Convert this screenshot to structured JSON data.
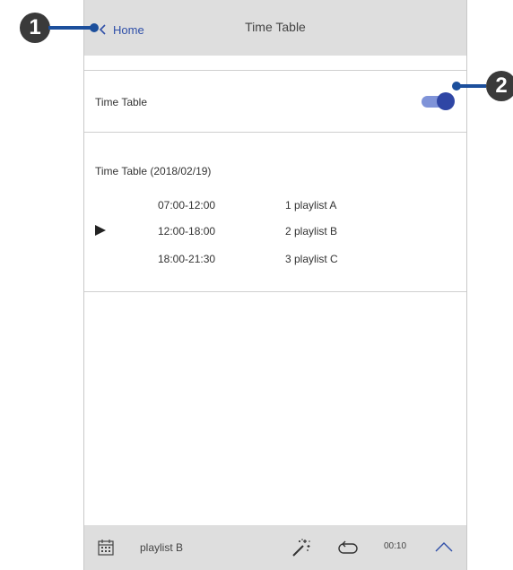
{
  "header": {
    "back_label": "Home",
    "title": "Time Table"
  },
  "settings": {
    "time_table_label": "Time Table",
    "time_table_enabled": true,
    "toggle_color": "#2f46a5"
  },
  "schedule": {
    "heading": "Time Table (2018/02/19)",
    "rows": [
      {
        "time": "07:00-12:00",
        "playlist": "1 playlist A",
        "current": false
      },
      {
        "time": "12:00-18:00",
        "playlist": "2 playlist B",
        "current": true
      },
      {
        "time": "18:00-21:30",
        "playlist": "3 playlist C",
        "current": false
      }
    ]
  },
  "bottom_bar": {
    "schedule_icon": "calendar-icon",
    "playlist_label": "playlist B",
    "effect_icon": "magic-wand-icon",
    "repeat_icon": "repeat-icon",
    "time": "00:10",
    "expand_icon": "chevron-up-icon"
  },
  "callouts": [
    "1",
    "2"
  ]
}
